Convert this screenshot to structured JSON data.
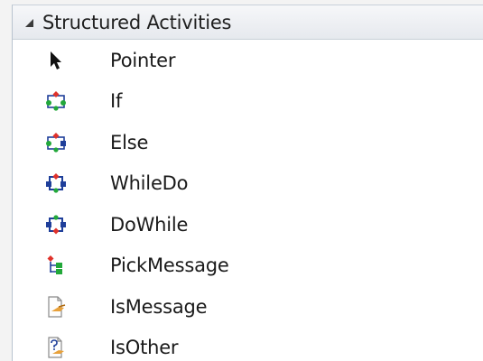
{
  "toolbox": {
    "group_title": "Structured Activities",
    "items": [
      {
        "label": "Pointer",
        "icon": "pointer-icon"
      },
      {
        "label": "If",
        "icon": "if-activity-icon"
      },
      {
        "label": "Else",
        "icon": "else-activity-icon"
      },
      {
        "label": "WhileDo",
        "icon": "whiledo-activity-icon"
      },
      {
        "label": "DoWhile",
        "icon": "dowhile-activity-icon"
      },
      {
        "label": "PickMessage",
        "icon": "pickmessage-activity-icon"
      },
      {
        "label": "IsMessage",
        "icon": "ismessage-activity-icon"
      },
      {
        "label": "IsOther",
        "icon": "isother-activity-icon"
      }
    ]
  },
  "colors": {
    "header_bg": "#e9ecf0",
    "icon_red": "#e0322b",
    "icon_green": "#22a83a",
    "icon_blue": "#1f3f9a"
  }
}
